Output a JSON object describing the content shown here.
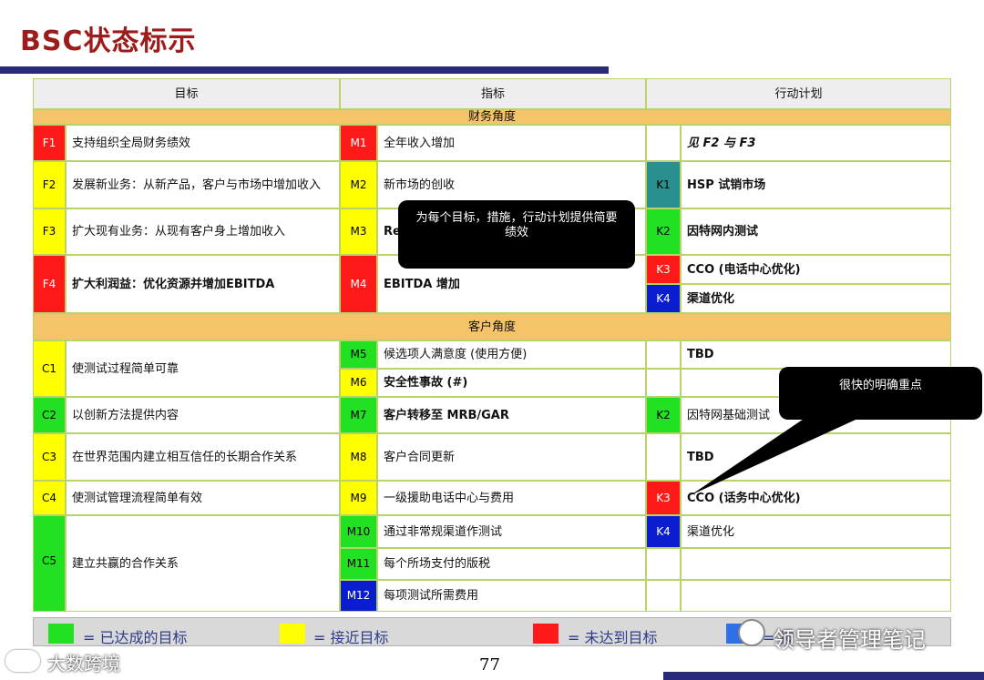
{
  "title": "BSC状态标示",
  "table": {
    "headers": {
      "goal": "目标",
      "metric": "指标",
      "action": "行动计划"
    },
    "section1": "财务角度",
    "section2": "客户角度",
    "rows": {
      "F1": {
        "code": "F1",
        "goal": "支持组织全局财务绩效",
        "mcode": "M1",
        "metric": "全年收入增加",
        "action": "见 F2 与 F3"
      },
      "F2": {
        "code": "F2",
        "goal": "发展新业务：从新产品，客户与市场中增加收入",
        "mcode": "M2",
        "metric": "新市场的创收",
        "kcode": "K1",
        "action": "HSP 试销市场"
      },
      "F3": {
        "code": "F3",
        "goal": "扩大现有业务：从现有客户身上增加收入",
        "mcode": "M3",
        "metric": "Re",
        "kcode": "K2",
        "action": "因特网内测试"
      },
      "F4": {
        "code": "F4",
        "goal": "扩大利润益：优化资源并增加EBITDA",
        "mcode": "M4",
        "metric": "EBITDA 增加",
        "k3code": "K3",
        "action3": "CCO (电话中心优化)",
        "k4code": "K4",
        "action4": "渠道优化"
      },
      "C1": {
        "code": "C1",
        "goal": "使测试过程简单可靠",
        "m5code": "M5",
        "metric5": "候选项人满意度 (使用方便)",
        "action5": "TBD",
        "m6code": "M6",
        "metric6": "安全性事故 (#)"
      },
      "C2": {
        "code": "C2",
        "goal": "以创新方法提供内容",
        "mcode": "M7",
        "metric": "客户转移至 MRB/GAR",
        "kcode": "K2",
        "action": "因特网基础测试"
      },
      "C3": {
        "code": "C3",
        "goal": "在世界范围内建立相互信任的长期合作关系",
        "mcode": "M8",
        "metric": "客户合同更新",
        "action": "TBD"
      },
      "C4": {
        "code": "C4",
        "goal": "使测试管理流程简单有效",
        "mcode": "M9",
        "metric": "一级援助电话中心与费用",
        "kcode": "K3",
        "action": "CCO (话务中心优化)"
      },
      "C5": {
        "code": "C5",
        "goal": "建立共赢的合作关系",
        "m10code": "M10",
        "metric10": "通过非常规渠道作测试",
        "k4code": "K4",
        "action10": "渠道优化",
        "m11code": "M11",
        "metric11": "每个所场支付的版税",
        "m12code": "M12",
        "metric12": "每项测试所需费用"
      }
    }
  },
  "callout1": "为每个目标，措施，行动计划提供简要绩效",
  "callout2": "很快的明确重点",
  "legend": {
    "achieved": "= 已达成的目标",
    "near": "= 接近目标",
    "missed": "= 未达到目标",
    "partial": "= 按"
  },
  "page_number": "77",
  "watermark_left": "大数跨境",
  "watermark_right": "领导者管理笔记",
  "colors": {
    "red": "#ff1a1a",
    "yellow": "#ffff00",
    "green": "#22e022",
    "blue": "#0a1ecf",
    "header_bar": "#2a2a7a",
    "title": "#9c1c1c",
    "section": "#f5c36a"
  }
}
